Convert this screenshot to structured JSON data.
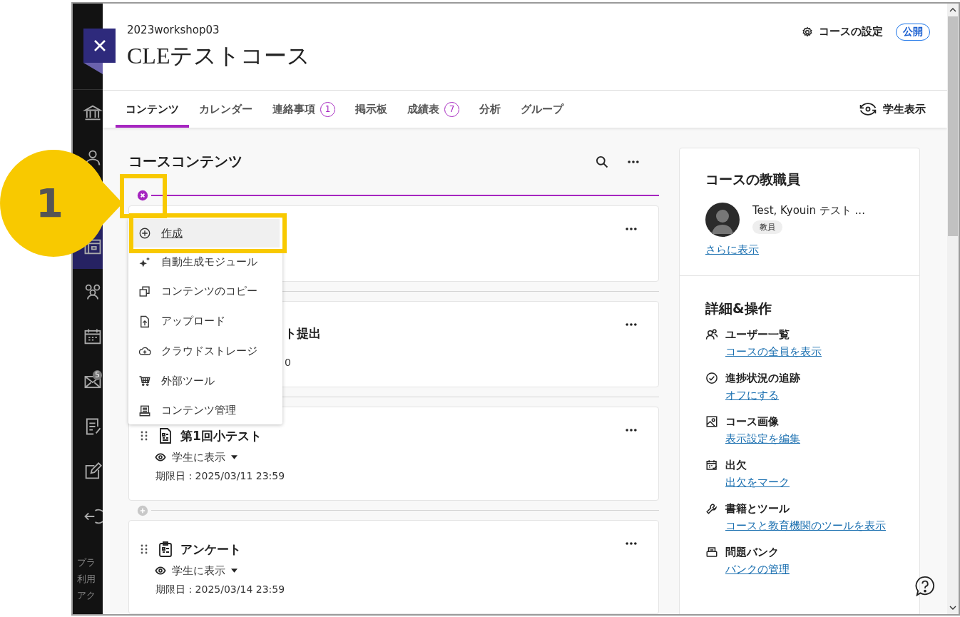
{
  "callout": {
    "number": "1"
  },
  "sidebar": {
    "items": [
      {
        "kind": "institution",
        "selected": false
      },
      {
        "kind": "person",
        "selected": false
      },
      {
        "kind": "courses",
        "selected": true
      },
      {
        "kind": "groups",
        "selected": false
      },
      {
        "kind": "calendar",
        "selected": false
      },
      {
        "kind": "mail",
        "selected": false,
        "badge": "5"
      },
      {
        "kind": "grades",
        "selected": false
      },
      {
        "kind": "edit",
        "selected": false
      },
      {
        "kind": "signout",
        "selected": false
      }
    ],
    "footer": [
      "プラ",
      "利用",
      "アク"
    ]
  },
  "course": {
    "code": "2023workshop03",
    "title": "CLEテストコース",
    "settings": "コースの設定",
    "status": "公開"
  },
  "tabs": [
    {
      "label": "コンテンツ",
      "selected": true
    },
    {
      "label": "カレンダー",
      "selected": false
    },
    {
      "label": "連絡事項",
      "count": "1",
      "selected": false
    },
    {
      "label": "掲示板",
      "selected": false
    },
    {
      "label": "成績表",
      "count": "7",
      "selected": false
    },
    {
      "label": "分析",
      "selected": false
    },
    {
      "label": "グループ",
      "selected": false
    }
  ],
  "student_view": "学生表示",
  "content": {
    "heading": "コースコンテンツ",
    "items": [
      {
        "kind": "covered"
      },
      {
        "kind": "covered",
        "title": "ト提出",
        "due": "0"
      },
      {
        "kind": "test",
        "add_button": false,
        "title": "第1回小テスト",
        "visibility": "学生に表示",
        "due": "期限日 : 2025/03/11 23:59"
      },
      {
        "kind": "survey",
        "add_button": true,
        "title": "アンケート",
        "visibility": "学生に表示",
        "due": "期限日 : 2025/03/14 23:59"
      }
    ]
  },
  "add_menu": {
    "items": [
      {
        "kind": "create",
        "label": "作成",
        "selected": true
      },
      {
        "kind": "generate",
        "label": "自動生成モジュール",
        "selected": false
      },
      {
        "kind": "copy",
        "label": "コンテンツのコピー",
        "selected": false
      },
      {
        "kind": "upload",
        "label": "アップロード",
        "selected": false
      },
      {
        "kind": "cloud",
        "label": "クラウドストレージ",
        "selected": false
      },
      {
        "kind": "tools",
        "label": "外部ツール",
        "selected": false
      },
      {
        "kind": "manage",
        "label": "コンテンツ管理",
        "selected": false
      }
    ]
  },
  "staff": {
    "title": "コースの教職員",
    "name": "Test, Kyouin テスト ...",
    "role": "教員",
    "more": "さらに表示"
  },
  "details": {
    "title": "詳細&操作",
    "items": [
      {
        "kind": "users",
        "label": "ユーザー一覧",
        "link": "コースの全員を表示"
      },
      {
        "kind": "progress",
        "label": "進捗状況の追跡",
        "link": "オフにする"
      },
      {
        "kind": "image",
        "label": "コース画像",
        "link": "表示設定を編集"
      },
      {
        "kind": "attendance",
        "label": "出欠",
        "link": "出欠をマーク"
      },
      {
        "kind": "tools",
        "label": "書籍とツール",
        "link": "コースと教育機関のツールを表示"
      },
      {
        "kind": "bank",
        "label": "問題バンク",
        "link": "バンクの管理"
      }
    ]
  }
}
